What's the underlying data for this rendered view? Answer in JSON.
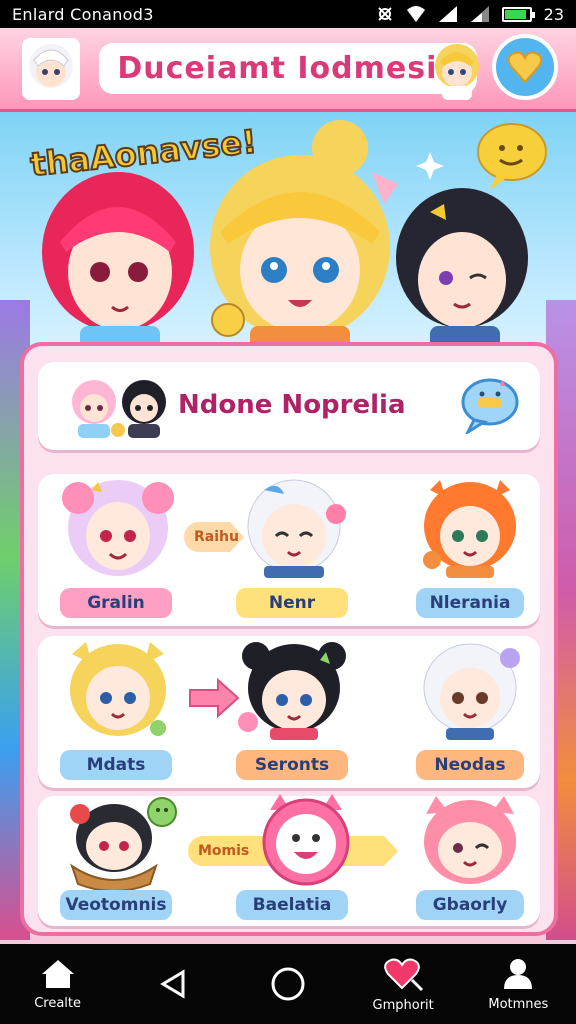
{
  "status_bar": {
    "left_text": "Enlard Conanod3",
    "battery_level": "23",
    "battery_fraction": 0.9
  },
  "header": {
    "title": "Duceiamt Iodmesia",
    "left_avatar_icon": "avatar-white-hair-icon",
    "right_avatar_icon": "avatar-blonde-icon",
    "menu_icon": "heart-icon"
  },
  "hero": {
    "title": "thaAonavse!",
    "speech_icon": "smile-bubble-icon"
  },
  "search_card": {
    "title": "Ndone Noprelia",
    "chat_icon": "chat-bubble-icon"
  },
  "rows": [
    {
      "pill_text": "Raihu",
      "labels": [
        "Gralin",
        "Nenr",
        "Nlerania"
      ]
    },
    {
      "pill_text": "",
      "labels": [
        "Mdats",
        "Seronts",
        "Neodas"
      ]
    },
    {
      "pill_text": "Momis",
      "labels": [
        "Veotomnis",
        "Baelatia",
        "Gbaorly"
      ]
    }
  ],
  "nav": {
    "items": [
      {
        "label": "Crealte",
        "icon": "home-icon"
      },
      {
        "label": "",
        "icon": "back-triangle-icon"
      },
      {
        "label": "",
        "icon": "circle-home-icon"
      },
      {
        "label": "Gmphorit",
        "icon": "heart-search-icon"
      },
      {
        "label": "Motmnes",
        "icon": "person-icon"
      }
    ]
  },
  "colors": {
    "accent_pink": "#ee6ea1",
    "title_pink": "#d93a78",
    "label_blue": "#9fd4f7",
    "label_yellow": "#ffe07a",
    "label_orange": "#ffb77d"
  }
}
